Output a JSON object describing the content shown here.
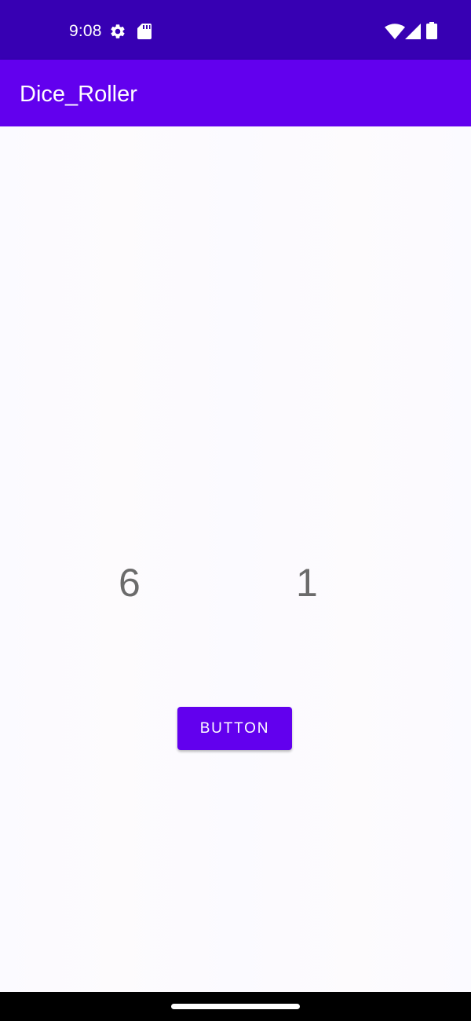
{
  "status_bar": {
    "time": "9:08",
    "left_icons": [
      "settings-gear-icon",
      "sd-card-icon"
    ],
    "right_icons": [
      "wifi-icon",
      "cell-signal-icon",
      "battery-icon"
    ],
    "background": "#3700b3"
  },
  "app_bar": {
    "title": "Dice_Roller",
    "background": "#6200ee"
  },
  "dice": {
    "left_value": "6",
    "right_value": "1"
  },
  "roll_button": {
    "label": "BUTTON",
    "background": "#6200ee"
  },
  "nav_bar": {
    "background": "#000000"
  }
}
